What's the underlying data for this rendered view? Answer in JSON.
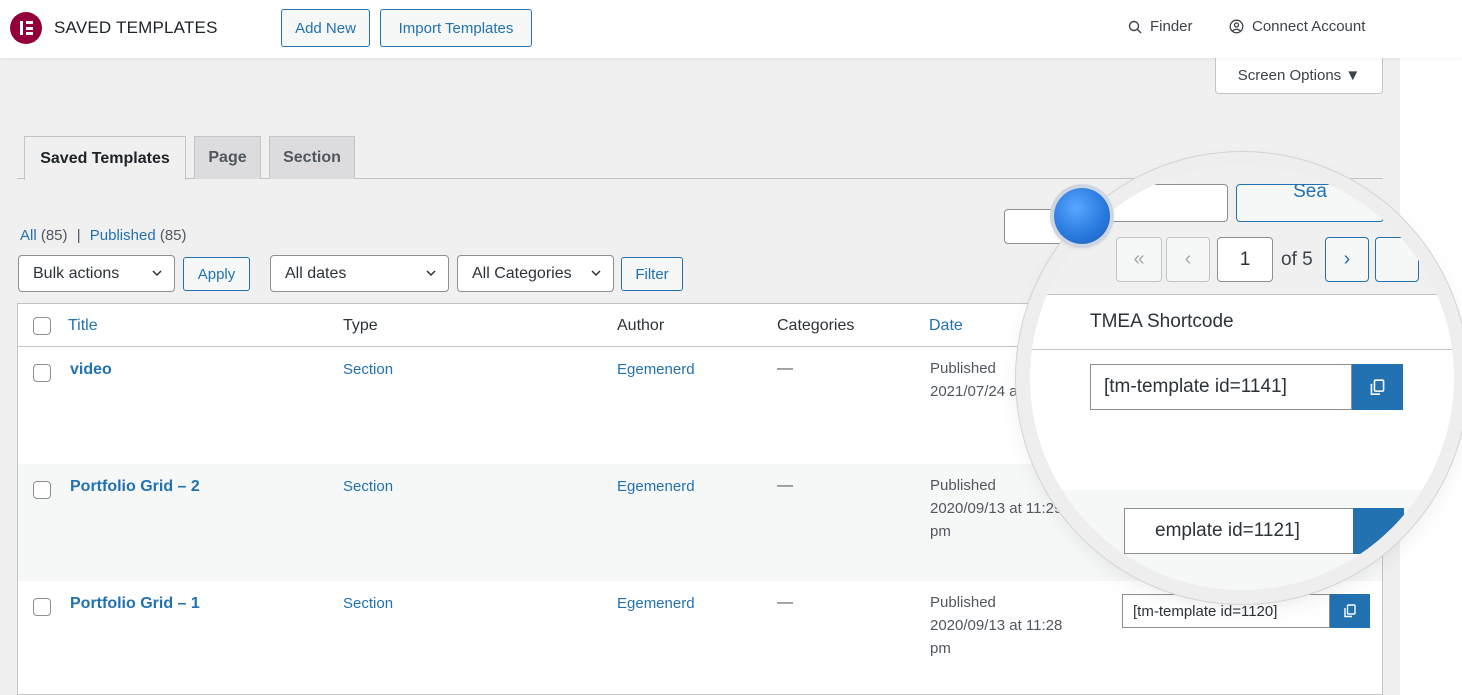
{
  "topbar": {
    "title": "SAVED TEMPLATES",
    "add_new": "Add New",
    "import": "Import Templates",
    "finder": "Finder",
    "connect": "Connect Account"
  },
  "screen_options": "Screen Options ▼",
  "tabs": [
    "Saved Templates",
    "Page",
    "Section"
  ],
  "filters": {
    "all": "All",
    "all_count": "(85)",
    "separator": "|",
    "published": "Published",
    "published_count": "(85)",
    "bulk_actions": "Bulk actions",
    "apply": "Apply",
    "all_dates": "All dates",
    "all_categories": "All Categories",
    "filter": "Filter"
  },
  "table": {
    "columns": [
      "Title",
      "Type",
      "Author",
      "Categories",
      "Date"
    ],
    "rows": [
      {
        "title": "video",
        "type": "Section",
        "author": "Egemenerd",
        "categories": "—",
        "status": "Published",
        "date": "2021/07/24 at"
      },
      {
        "title": "Portfolio Grid – 2",
        "type": "Section",
        "author": "Egemenerd",
        "categories": "—",
        "status": "Published",
        "date": "2020/09/13 at 11:29",
        "date_suffix": "pm"
      },
      {
        "title": "Portfolio Grid – 1",
        "type": "Section",
        "author": "Egemenerd",
        "categories": "—",
        "status": "Published",
        "date": "2020/09/13 at 11:28",
        "date_suffix": "pm",
        "shortcode": "[tm-template id=1120]"
      }
    ]
  },
  "magnifier": {
    "search_partial": "Sea",
    "pagination": {
      "first": "«",
      "prev": "‹",
      "current": "1",
      "of": "of 5",
      "next": "›"
    },
    "column_header": "TMEA Shortcode",
    "shortcode_1": "[tm-template id=1141]",
    "shortcode_2_partial": "emplate id=1121]"
  },
  "colors": {
    "accent": "#2271b1",
    "brand": "#92003b",
    "background": "#f0f0f1"
  },
  "icons": [
    "elementor-logo-icon",
    "search-icon",
    "user-circle-icon",
    "chevron-down-icon",
    "copy-icon"
  ]
}
